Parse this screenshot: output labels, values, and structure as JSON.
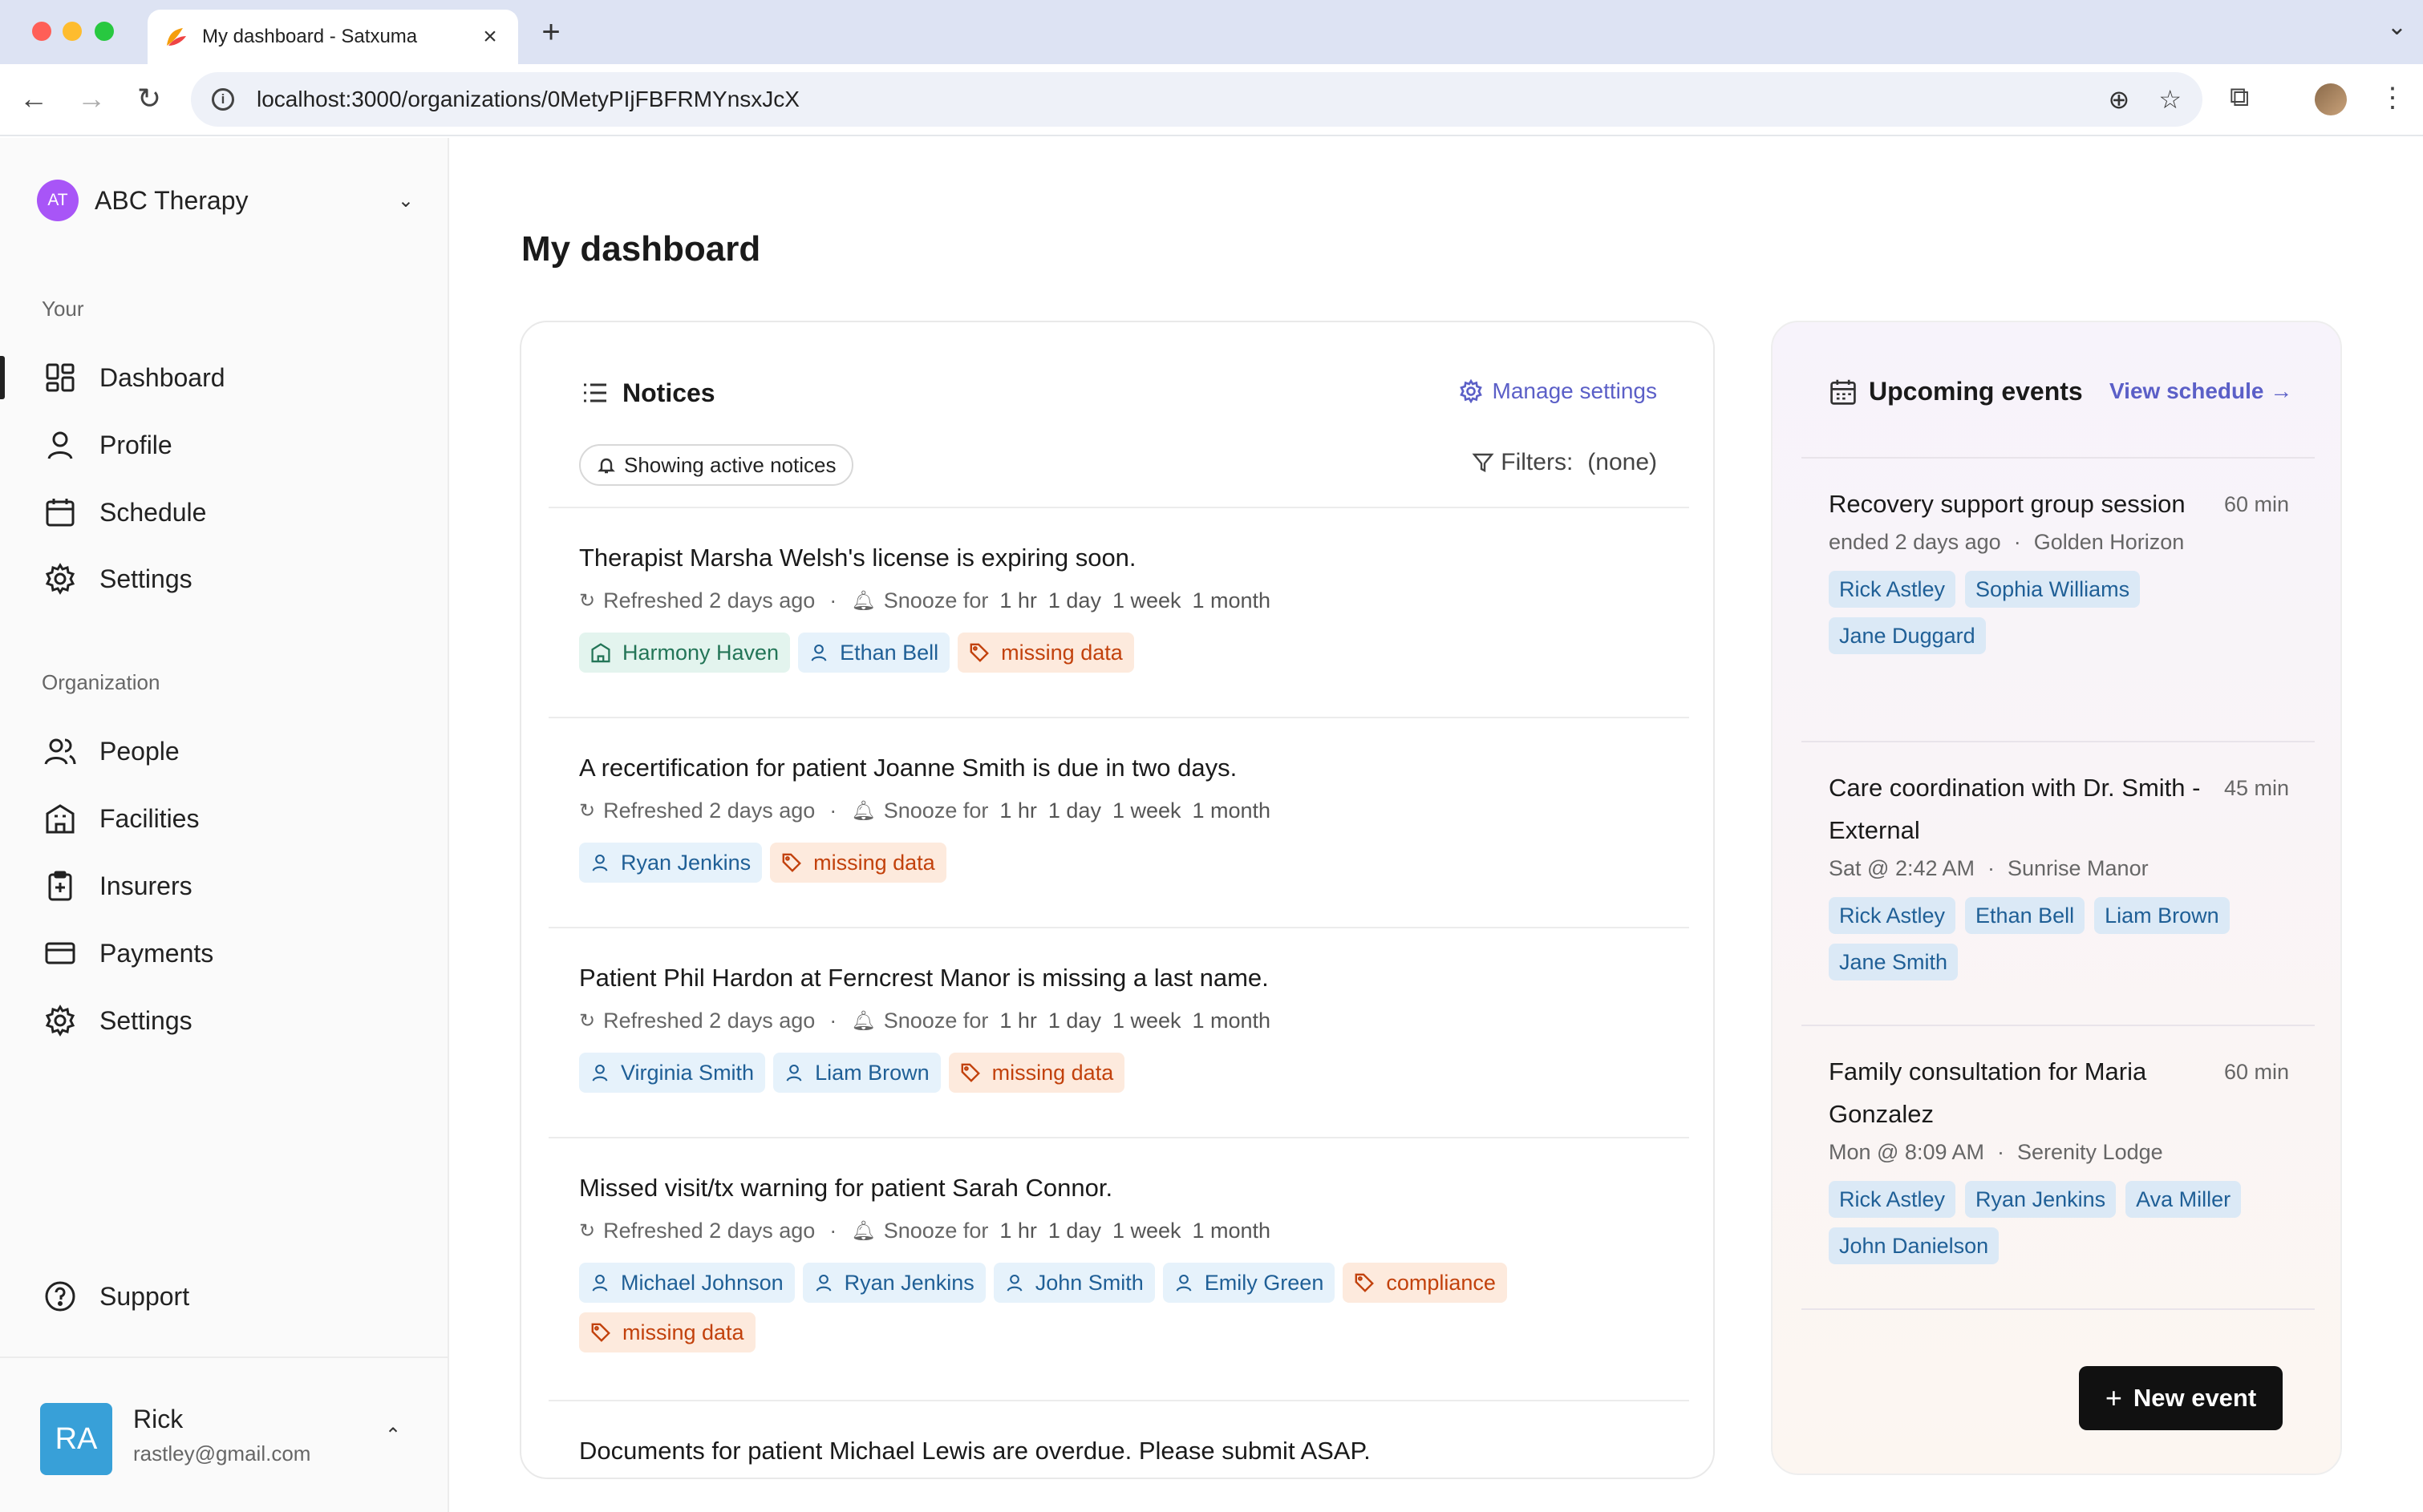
{
  "browser": {
    "tab_title": "My dashboard - Satxuma",
    "url": "localhost:3000/organizations/0MetyPIjFBFRMYnsxJcX"
  },
  "org": {
    "initials": "AT",
    "name": "ABC Therapy"
  },
  "sidebar": {
    "your_label": "Your",
    "your_items": [
      {
        "label": "Dashboard",
        "icon": "dashboard-icon"
      },
      {
        "label": "Profile",
        "icon": "person-icon"
      },
      {
        "label": "Schedule",
        "icon": "calendar-icon"
      },
      {
        "label": "Settings",
        "icon": "gear-icon"
      }
    ],
    "org_label": "Organization",
    "org_items": [
      {
        "label": "People",
        "icon": "people-icon"
      },
      {
        "label": "Facilities",
        "icon": "building-icon"
      },
      {
        "label": "Insurers",
        "icon": "clipboard-plus-icon"
      },
      {
        "label": "Payments",
        "icon": "credit-card-icon"
      },
      {
        "label": "Settings",
        "icon": "gear-icon"
      }
    ],
    "support_label": "Support"
  },
  "user": {
    "initials": "RA",
    "name": "Rick",
    "email": "rastley@gmail.com"
  },
  "page": {
    "title": "My dashboard"
  },
  "notices": {
    "heading": "Notices",
    "manage_label": "Manage settings",
    "showing_label": "Showing active notices",
    "filters_label": "Filters:",
    "filters_value": "(none)",
    "refreshed": "Refreshed 2 days ago",
    "snooze_label": "Snooze for",
    "snooze_options": [
      "1 hr",
      "1 day",
      "1 week",
      "1 month"
    ],
    "items": [
      {
        "title": "Therapist Marsha Welsh's license is expiring soon.",
        "tags": [
          {
            "type": "facility",
            "label": "Harmony Haven"
          },
          {
            "type": "person",
            "label": "Ethan Bell"
          },
          {
            "type": "data",
            "label": "missing data"
          }
        ]
      },
      {
        "title": "A recertification for patient Joanne Smith is due in two days.",
        "tags": [
          {
            "type": "person",
            "label": "Ryan Jenkins"
          },
          {
            "type": "data",
            "label": "missing data"
          }
        ]
      },
      {
        "title": "Patient Phil Hardon at Ferncrest Manor is missing a last name.",
        "tags": [
          {
            "type": "person",
            "label": "Virginia Smith"
          },
          {
            "type": "person",
            "label": "Liam Brown"
          },
          {
            "type": "data",
            "label": "missing data"
          }
        ]
      },
      {
        "title": "Missed visit/tx warning for patient Sarah Connor.",
        "tags": [
          {
            "type": "person",
            "label": "Michael Johnson"
          },
          {
            "type": "person",
            "label": "Ryan Jenkins"
          },
          {
            "type": "person",
            "label": "John Smith"
          },
          {
            "type": "person",
            "label": "Emily Green"
          },
          {
            "type": "data",
            "label": "compliance"
          },
          {
            "type": "data",
            "label": "missing data"
          }
        ]
      },
      {
        "title": "Documents for patient Michael Lewis are overdue. Please submit ASAP.",
        "tags": []
      }
    ]
  },
  "events": {
    "heading": "Upcoming events",
    "view_schedule": "View schedule →",
    "new_event": "New event",
    "items": [
      {
        "title": "Recovery support group session",
        "duration": "60 min",
        "when": "ended 2 days ago",
        "place": "Golden Horizon",
        "people": [
          "Rick Astley",
          "Sophia Williams",
          "Jane Duggard"
        ]
      },
      {
        "title": "Care coordination with Dr. Smith - External",
        "duration": "45 min",
        "when": "Sat @ 2:42 AM",
        "place": "Sunrise Manor",
        "people": [
          "Rick Astley",
          "Ethan Bell",
          "Liam Brown",
          "Jane Smith"
        ]
      },
      {
        "title": "Family consultation for Maria Gonzalez",
        "duration": "60 min",
        "when": "Mon @ 8:09 AM",
        "place": "Serenity Lodge",
        "people": [
          "Rick Astley",
          "Ryan Jenkins",
          "Ava Miller",
          "John Danielson"
        ]
      }
    ]
  },
  "colors": {
    "accent": "#5b5fc7",
    "person_tag_bg": "#e6f2fb",
    "facility_tag_bg": "#e3f4ee",
    "data_tag_bg": "#fdeadd",
    "org_badge": "#a855f7",
    "user_avatar": "#38a0d8"
  }
}
